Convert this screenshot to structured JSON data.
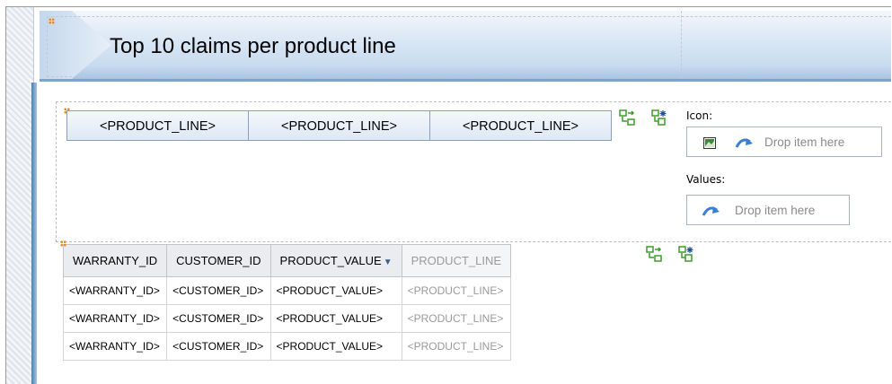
{
  "report": {
    "title": "Top 10 claims per product line"
  },
  "crosstab": {
    "columns": [
      "<PRODUCT_LINE>",
      "<PRODUCT_LINE>",
      "<PRODUCT_LINE>"
    ]
  },
  "icon_zone": {
    "label": "Icon:",
    "placeholder": "Drop item here"
  },
  "values_zone": {
    "label": "Values:",
    "placeholder": "Drop item here"
  },
  "table": {
    "headers": [
      "WARRANTY_ID",
      "CUSTOMER_ID",
      "PRODUCT_VALUE",
      "PRODUCT_LINE"
    ],
    "sort_indicator": "▼",
    "rows": [
      [
        "<WARRANTY_ID>",
        "<CUSTOMER_ID>",
        "<PRODUCT_VALUE>",
        "<PRODUCT_LINE>"
      ],
      [
        "<WARRANTY_ID>",
        "<CUSTOMER_ID>",
        "<PRODUCT_VALUE>",
        "<PRODUCT_LINE>"
      ],
      [
        "<WARRANTY_ID>",
        "<CUSTOMER_ID>",
        "<PRODUCT_VALUE>",
        "<PRODUCT_LINE>"
      ]
    ]
  },
  "colors": {
    "banner_accent": "#7ea3cf",
    "drop_arrow": "#3b7fd4",
    "tool_green": "#3e9a2c"
  },
  "icons": [
    "insert-column-icon",
    "crosstab-properties-icon",
    "image-icon",
    "drop-arrow-icon"
  ]
}
